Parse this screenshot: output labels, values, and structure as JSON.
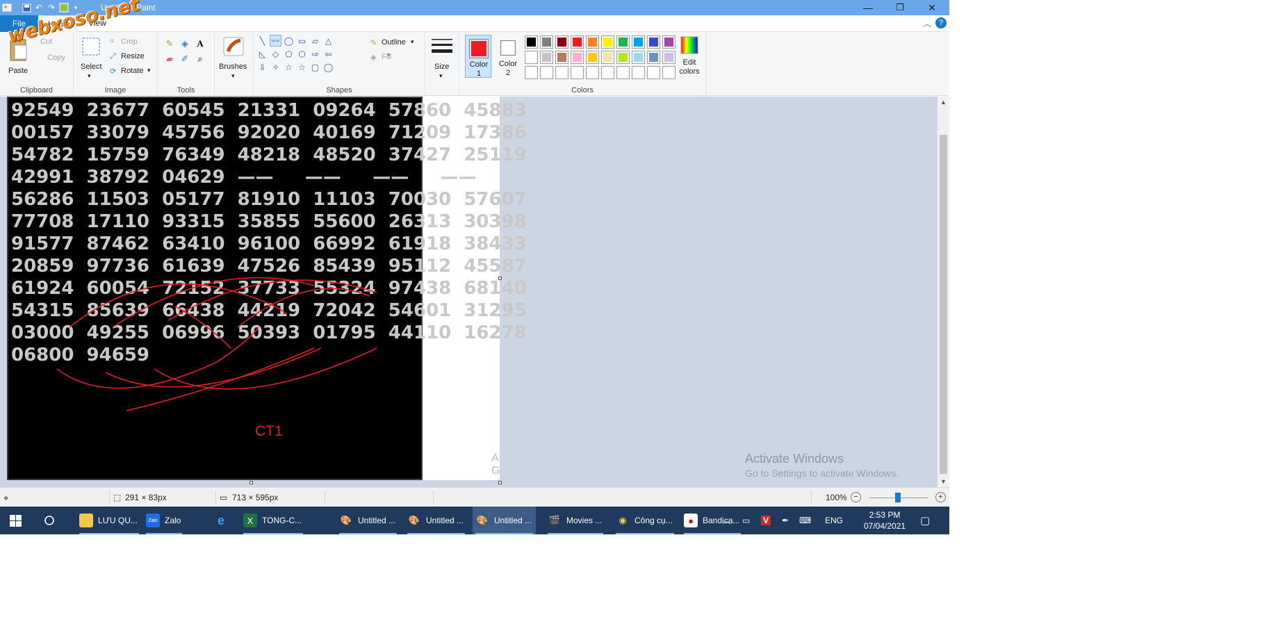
{
  "window": {
    "title": "Untitled - Paint",
    "minimize": "—",
    "maximize": "❐",
    "close": "✕"
  },
  "watermark": "webxoso.net",
  "tabs": {
    "file": "File",
    "home": "Home",
    "view": "View"
  },
  "ribbon": {
    "clipboard": {
      "paste": "Paste",
      "cut": "Cut",
      "copy": "Copy",
      "label": "Clipboard"
    },
    "image": {
      "select": "Select",
      "crop": "Crop",
      "resize": "Resize",
      "rotate": "Rotate",
      "label": "Image"
    },
    "tools": {
      "label": "Tools"
    },
    "brushes": {
      "label": "Brushes"
    },
    "shapes": {
      "outline": "Outline",
      "fill": "Fill",
      "label": "Shapes"
    },
    "size": {
      "label": "Size"
    },
    "colors": {
      "color1": "Color 1",
      "color2": "Color 2",
      "edit": "Edit colors",
      "label": "Colors",
      "color1_value": "#ed1c24",
      "color2_value": "#ffffff",
      "palette_row1": [
        "#000000",
        "#7f7f7f",
        "#880015",
        "#ed1c24",
        "#ff7f27",
        "#fff200",
        "#22b14c",
        "#00a2e8",
        "#3f48cc",
        "#a349a4"
      ],
      "palette_row2": [
        "#ffffff",
        "#c3c3c3",
        "#b97a57",
        "#ffaec9",
        "#ffc90e",
        "#efe4b0",
        "#b5e61d",
        "#99d9ea",
        "#7092be",
        "#c8bfe7"
      ],
      "palette_row3": [
        "#ffffff",
        "#ffffff",
        "#ffffff",
        "#ffffff",
        "#ffffff",
        "#ffffff",
        "#ffffff",
        "#ffffff",
        "#ffffff",
        "#ffffff"
      ]
    }
  },
  "canvas": {
    "number_rows": [
      "92549  23677  60545  21331  09264  57860  45883",
      "00157  33079  45756  92020  40169  71209  17386",
      "54782  15759  76349  48218  48520  37427  25119",
      "42991  38792  04629  ——     ——     ——     ——",
      "56286  11503  05177  81910  11103  70030  57607",
      "77708  17110  93315  35855  55600  26313  30398",
      "91577  87462  63410  96100  66992  61918  38433",
      "20859  97736  61639  47526  85439  95112  45587",
      "61924  60054  72152  37733  55324  97438  68140",
      "54315  85639  66438  44219  72042  54601  31295",
      "03000  49255  06996  50393  01795  44110  16278",
      "06800  94659"
    ],
    "annotation": "CT1",
    "activate_title": "Activate Windows",
    "activate_sub": "Go to Settings to activate Windows.",
    "fragment": "A\nG"
  },
  "statusbar": {
    "selection_size": "291 × 83px",
    "canvas_size": "713 × 595px",
    "zoom": "100%"
  },
  "taskbar": {
    "items": [
      "LƯU QU...",
      "Zalo",
      "TONG-C...",
      "Untitled ...",
      "Untitled ...",
      "Untitled ...",
      "Movies ...",
      "Công cụ...",
      "Bandica..."
    ],
    "lang": "ENG",
    "time": "2:53 PM",
    "date": "07/04/2021"
  }
}
